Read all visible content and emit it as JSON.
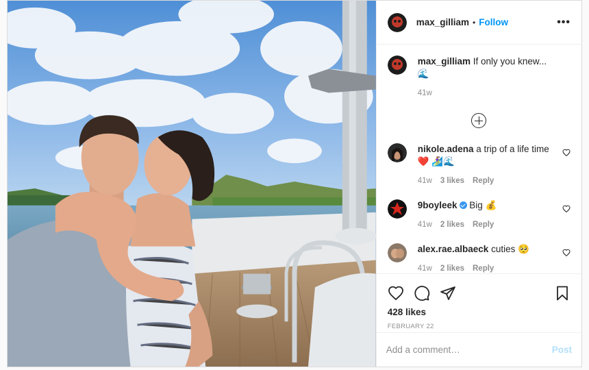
{
  "post": {
    "author": {
      "username": "max_gilliam",
      "follow_label": "Follow",
      "dot": "•",
      "more_label": "•••"
    },
    "caption": {
      "username": "max_gilliam",
      "text": "If only you knew...🌊",
      "age": "41w"
    },
    "comments": [
      {
        "username": "nikole.adena",
        "text": "a trip of a life time ❤️ 🏄‍♀️🌊",
        "age": "41w",
        "likes": "3 likes",
        "reply": "Reply",
        "verified": false
      },
      {
        "username": "9boyleek",
        "text": "Big 💰",
        "age": "41w",
        "likes": "2 likes",
        "reply": "Reply",
        "verified": true
      },
      {
        "username": "alex.rae.albaeck",
        "text": "cuties 🥺",
        "age": "41w",
        "likes": "2 likes",
        "reply": "Reply",
        "verified": false
      }
    ],
    "likes": "428 likes",
    "date": "February 22",
    "comment_placeholder": "Add a comment…",
    "post_label": "Post"
  },
  "icons": {
    "like": "heart-outline-icon",
    "comment": "speech-bubble-icon",
    "share": "paper-plane-icon",
    "save": "bookmark-icon",
    "load_more": "plus-circle-icon",
    "comment_like": "heart-small-icon",
    "verified": "verified-badge-icon"
  },
  "colors": {
    "accent": "#0095f6",
    "post_disabled": "#b2dffc",
    "muted": "#8e8e8e",
    "verified": "#3897f0",
    "heart": "#ed4956"
  }
}
